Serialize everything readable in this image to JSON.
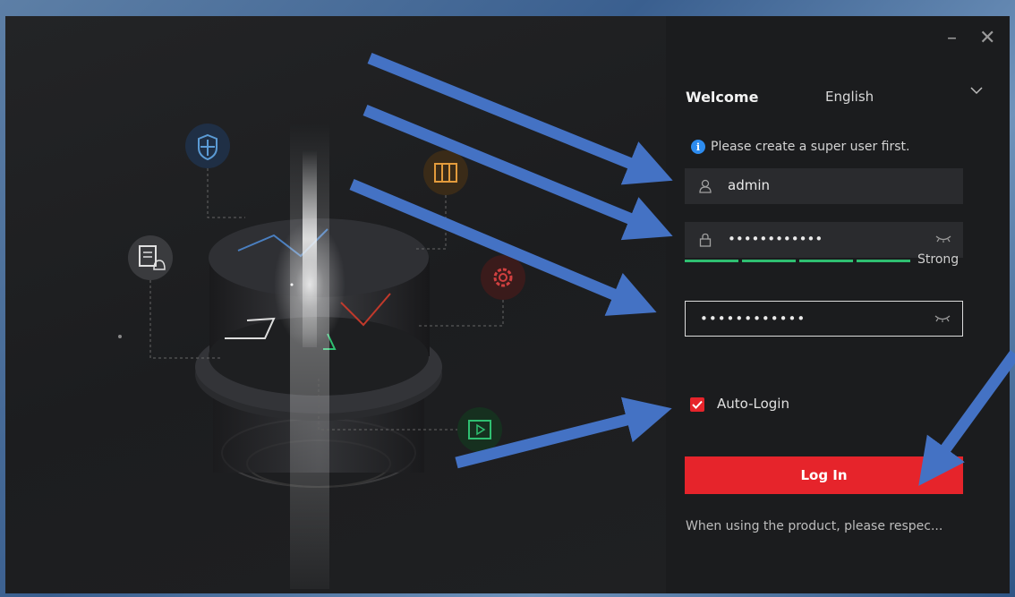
{
  "login": {
    "welcome": "Welcome",
    "language": "English",
    "notice": "Please create a super user first.",
    "username": "admin",
    "password_mask": "••••••••••••",
    "confirm_mask": "••••••••••••",
    "strength_label": "Strong",
    "strength_level": 1.0,
    "auto_login_label": "Auto-Login",
    "auto_login_checked": true,
    "login_button": "Log In",
    "footer": "When using the product, please respec..."
  },
  "window": {
    "minimize": "–",
    "close": "✕"
  },
  "icons": {
    "user": "user-icon",
    "lock": "lock-icon",
    "eye": "eye-closed-icon",
    "info": "info-icon",
    "chevron": "chevron-down-icon"
  },
  "colors": {
    "accent": "#e6242b",
    "strength": "#2fbf71",
    "info": "#2d8cf0",
    "arrow": "#4472c4"
  }
}
